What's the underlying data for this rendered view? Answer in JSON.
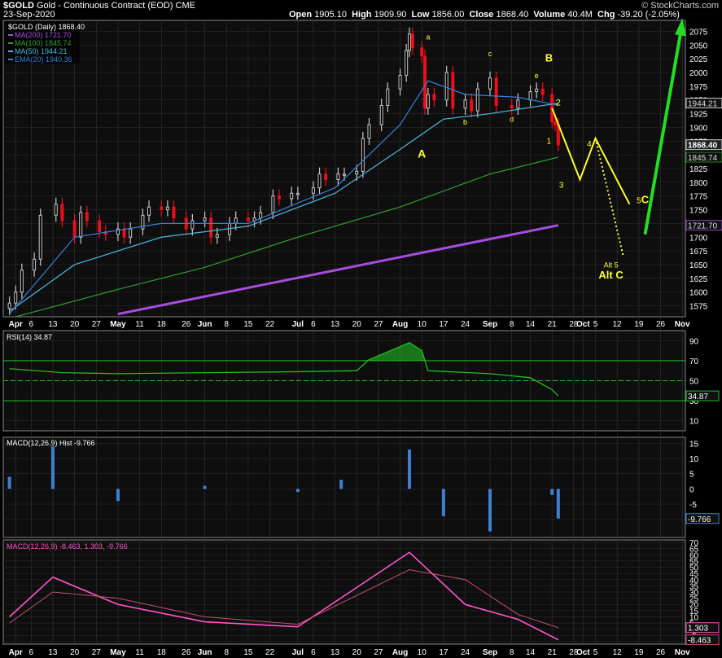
{
  "header": {
    "ticker": "$GOLD",
    "description": "Gold - Continuous Contract (EOD)",
    "exchange": "CME",
    "date": "23-Sep-2020",
    "open_label": "Open",
    "open": "1905.10",
    "high_label": "High",
    "high": "1909.90",
    "low_label": "Low",
    "low": "1856.00",
    "close_label": "Close",
    "close": "1868.40",
    "volume_label": "Volume",
    "volume": "40.4M",
    "chg_label": "Chg",
    "chg": "-39.20 (-2.05%)",
    "logo": "© StockCharts.com"
  },
  "colors": {
    "background": "#000000",
    "panel": "#0e0e0e",
    "shade": "#262626",
    "up": "#c8c8c8",
    "down": "#e8101a",
    "ma200": "#a64de0",
    "ma100": "#2f9e2f",
    "ma50": "#4ab8dc",
    "ema20": "#3a7fd8",
    "wave": "#ffff33",
    "projection": "#22dd22",
    "rsi": "#22bb22",
    "macd_hist": "#3f7fd0",
    "macd_line": "#ff55cc",
    "macd_signal": "#c05070"
  },
  "chart_data": [
    {
      "type": "candlestick",
      "title": "$GOLD (Daily) 1868.40",
      "x": [
        "2020-03-30",
        "2020-04-01",
        "2020-04-03",
        "2020-04-07",
        "2020-04-09",
        "2020-04-14",
        "2020-04-16",
        "2020-04-20",
        "2020-04-22",
        "2020-04-24",
        "2020-04-28",
        "2020-04-30",
        "2020-05-04",
        "2020-05-06",
        "2020-05-08",
        "2020-05-12",
        "2020-05-14",
        "2020-05-18",
        "2020-05-20",
        "2020-05-22",
        "2020-05-26",
        "2020-05-28",
        "2020-06-01",
        "2020-06-03",
        "2020-06-05",
        "2020-06-09",
        "2020-06-11",
        "2020-06-15",
        "2020-06-17",
        "2020-06-19",
        "2020-06-23",
        "2020-06-25",
        "2020-06-29",
        "2020-07-01",
        "2020-07-06",
        "2020-07-08",
        "2020-07-10",
        "2020-07-14",
        "2020-07-16",
        "2020-07-20",
        "2020-07-22",
        "2020-07-24",
        "2020-07-28",
        "2020-07-30",
        "2020-08-03",
        "2020-08-05",
        "2020-08-06",
        "2020-08-07",
        "2020-08-10",
        "2020-08-11",
        "2020-08-12",
        "2020-08-14",
        "2020-08-18",
        "2020-08-20",
        "2020-08-24",
        "2020-08-26",
        "2020-08-28",
        "2020-09-01",
        "2020-09-03",
        "2020-09-08",
        "2020-09-10",
        "2020-09-14",
        "2020-09-16",
        "2020-09-18",
        "2020-09-21",
        "2020-09-22",
        "2020-09-23"
      ],
      "close": [
        1580,
        1600,
        1640,
        1660,
        1740,
        1760,
        1730,
        1700,
        1745,
        1730,
        1710,
        1705,
        1715,
        1700,
        1715,
        1740,
        1755,
        1750,
        1755,
        1735,
        1715,
        1730,
        1735,
        1700,
        1705,
        1725,
        1735,
        1730,
        1735,
        1745,
        1775,
        1770,
        1780,
        1780,
        1790,
        1815,
        1805,
        1815,
        1815,
        1820,
        1880,
        1905,
        1940,
        1970,
        1995,
        2040,
        2070,
        2045,
        2030,
        1935,
        1960,
        1950,
        2000,
        1935,
        1950,
        1930,
        1970,
        1990,
        1940,
        1935,
        1950,
        1965,
        1970,
        1960,
        1910,
        1905,
        1868
      ]
    },
    {
      "type": "line",
      "series": [
        {
          "name": "MA(200) 1721.70",
          "x": [
            "2020-05-04",
            "2020-09-23"
          ],
          "values": [
            1560,
            1721.7
          ]
        },
        {
          "name": "MA(100) 1845.74",
          "x": [
            "2020-04-01",
            "2020-05-04",
            "2020-06-01",
            "2020-07-01",
            "2020-08-03",
            "2020-09-01",
            "2020-09-23"
          ],
          "values": [
            1555,
            1605,
            1645,
            1700,
            1755,
            1815,
            1845.74
          ]
        },
        {
          "name": "MA(50) 1944.21",
          "x": [
            "2020-03-30",
            "2020-04-20",
            "2020-05-18",
            "2020-06-15",
            "2020-07-13",
            "2020-08-03",
            "2020-08-17",
            "2020-09-01",
            "2020-09-23"
          ],
          "values": [
            1565,
            1650,
            1700,
            1720,
            1780,
            1860,
            1915,
            1925,
            1944.21
          ]
        },
        {
          "name": "EMA(20) 1940.36",
          "x": [
            "2020-03-30",
            "2020-04-20",
            "2020-05-18",
            "2020-06-15",
            "2020-07-13",
            "2020-08-03",
            "2020-08-12",
            "2020-08-24",
            "2020-09-10",
            "2020-09-23"
          ],
          "values": [
            1560,
            1700,
            1725,
            1725,
            1790,
            1905,
            1985,
            1960,
            1955,
            1940.36
          ]
        }
      ],
      "yticks": [
        1575,
        1600,
        1625,
        1650,
        1675,
        1700,
        1725,
        1750,
        1775,
        1800,
        1825,
        1850,
        1875,
        1900,
        1925,
        1950,
        1975,
        2000,
        2025,
        2050,
        2075
      ],
      "ylim": [
        1555,
        2095
      ],
      "last_value_labels": [
        "1944.21",
        "1868.40",
        "1845.74",
        "1721.70"
      ],
      "annotations": [
        "A",
        "a",
        "b",
        "c",
        "d",
        "e",
        "B",
        "1",
        "2",
        "3",
        "4",
        "5",
        "C",
        "Alt 5",
        "Alt C"
      ]
    },
    {
      "type": "line",
      "title": "RSI(14) 34.87",
      "x": [
        "2020-03-30",
        "2020-04-16",
        "2020-05-04",
        "2020-06-01",
        "2020-07-01",
        "2020-07-20",
        "2020-07-24",
        "2020-08-06",
        "2020-08-10",
        "2020-08-12",
        "2020-09-01",
        "2020-09-14",
        "2020-09-21",
        "2020-09-23"
      ],
      "values": [
        62,
        58,
        57,
        58,
        59,
        60,
        71,
        88,
        80,
        60,
        57,
        53,
        41,
        34.87
      ],
      "yticks": [
        10,
        30,
        50,
        70,
        90
      ],
      "ylim": [
        0,
        100
      ],
      "reference_lines": [
        30,
        50,
        70
      ],
      "last_value_label": "34.87"
    },
    {
      "type": "bar",
      "title": "MACD(12,26,9) Hist -9.766",
      "x": [
        "2020-03-30",
        "2020-04-13",
        "2020-05-04",
        "2020-06-01",
        "2020-07-01",
        "2020-07-15",
        "2020-08-06",
        "2020-08-17",
        "2020-09-01",
        "2020-09-21",
        "2020-09-23"
      ],
      "values": [
        4,
        14,
        -4,
        1,
        -1,
        3,
        13,
        -9,
        -14,
        -2,
        -9.766
      ],
      "yticks": [
        -10,
        -5,
        0,
        5,
        10,
        15
      ],
      "ylim": [
        -16,
        17
      ],
      "last_value_label": "-9.766"
    },
    {
      "type": "line",
      "title": "MACD(12,26,9) -8.463, 1.303, -9.766",
      "series": [
        {
          "name": "MACD",
          "x": [
            "2020-03-30",
            "2020-04-13",
            "2020-05-04",
            "2020-06-01",
            "2020-07-01",
            "2020-08-06",
            "2020-08-24",
            "2020-09-10",
            "2020-09-23"
          ],
          "values": [
            10,
            42,
            20,
            6,
            2,
            62,
            20,
            8,
            -8.463
          ]
        },
        {
          "name": "Signal",
          "x": [
            "2020-03-30",
            "2020-04-13",
            "2020-05-04",
            "2020-06-01",
            "2020-07-01",
            "2020-08-06",
            "2020-08-24",
            "2020-09-10",
            "2020-09-23"
          ],
          "values": [
            5,
            30,
            25,
            10,
            4,
            48,
            40,
            12,
            1.303
          ]
        }
      ],
      "yticks": [
        -10,
        -5,
        0,
        5,
        10,
        15,
        20,
        25,
        30,
        35,
        40,
        45,
        50,
        55,
        60,
        65,
        70
      ],
      "ylim": [
        -12,
        72
      ],
      "last_value_labels": [
        "1.303",
        "-8.463"
      ]
    }
  ],
  "xaxis": {
    "labels": [
      "Apr",
      "6",
      "13",
      "20",
      "27",
      "May",
      "11",
      "18",
      "26",
      "Jun",
      "8",
      "15",
      "22",
      "Jul",
      "6",
      "13",
      "20",
      "27",
      "Aug",
      "10",
      "17",
      "24",
      "Sep",
      "8",
      "14",
      "21",
      "28",
      "Oct",
      "5",
      "12",
      "19",
      "26",
      "Nov"
    ]
  }
}
